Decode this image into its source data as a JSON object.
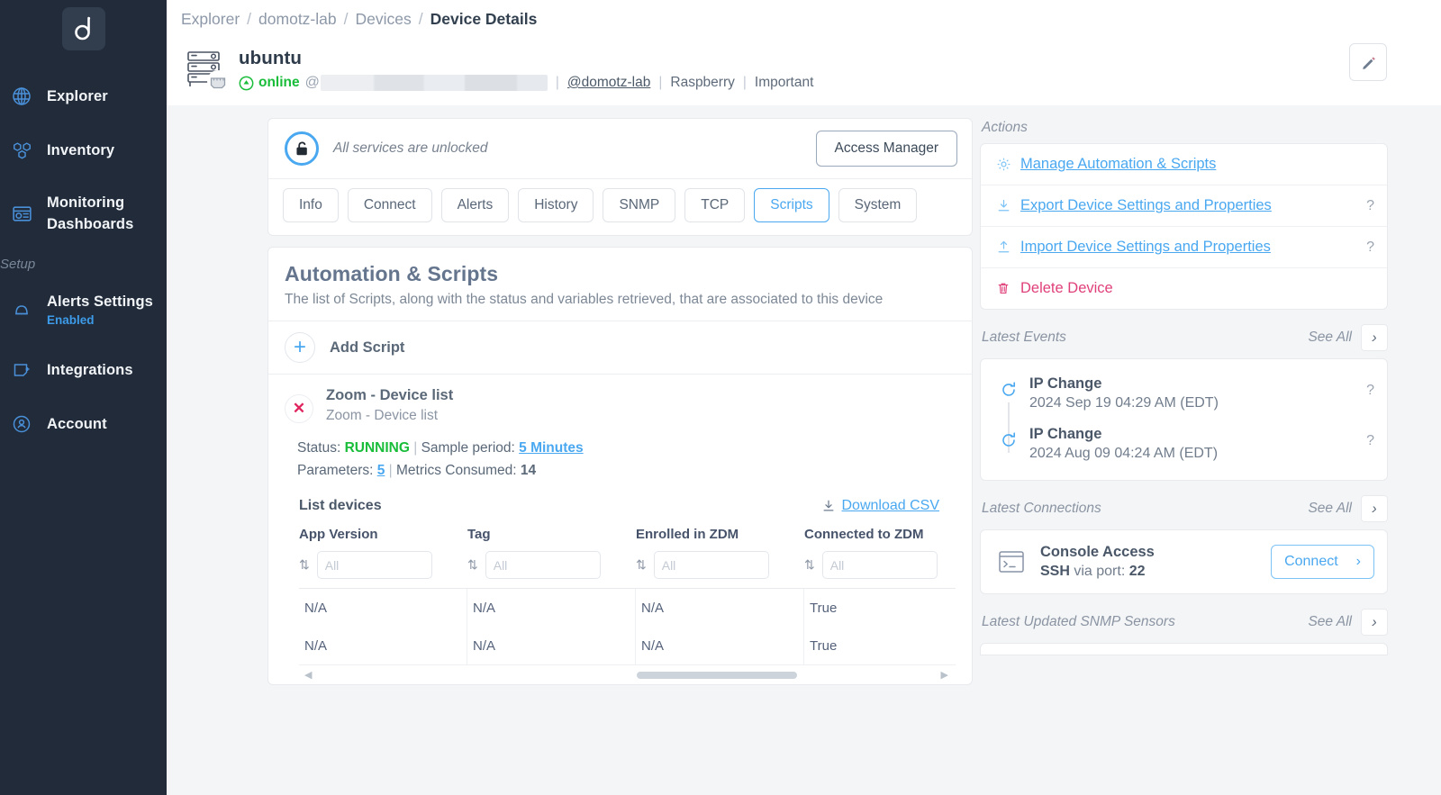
{
  "sidebar": {
    "logo_name": "domotz-logo",
    "items": [
      {
        "label": "Explorer",
        "icon": "globe-icon"
      },
      {
        "label": "Inventory",
        "icon": "cubes-icon"
      },
      {
        "label": "Monitoring Dashboards",
        "icon": "dashboard-icon"
      }
    ],
    "setup_label": "Setup",
    "setup_items": [
      {
        "label": "Alerts Settings",
        "sub": "Enabled",
        "icon": "bell-icon"
      },
      {
        "label": "Integrations",
        "sub": "",
        "icon": "integrations-icon"
      },
      {
        "label": "Account",
        "sub": "",
        "icon": "account-icon"
      }
    ]
  },
  "breadcrumb": {
    "items": [
      "Explorer",
      "domotz-lab",
      "Devices"
    ],
    "current": "Device Details",
    "separator": "/"
  },
  "device": {
    "name": "ubuntu",
    "status": "online",
    "at_symbol": "@",
    "ip_redacted": true,
    "group_link": "@domotz-lab",
    "tags": [
      "Raspberry",
      "Important"
    ],
    "edit_icon": "pencil-icon"
  },
  "access": {
    "message": "All services are unlocked",
    "button_label": "Access Manager",
    "lock_icon": "unlocked-padlock-icon"
  },
  "tabs": [
    {
      "label": "Info",
      "active": false
    },
    {
      "label": "Connect",
      "active": false
    },
    {
      "label": "Alerts",
      "active": false
    },
    {
      "label": "History",
      "active": false
    },
    {
      "label": "SNMP",
      "active": false
    },
    {
      "label": "TCP",
      "active": false
    },
    {
      "label": "Scripts",
      "active": true
    },
    {
      "label": "System",
      "active": false
    }
  ],
  "automation": {
    "title": "Automation & Scripts",
    "description": "The list of Scripts, along with the status and variables retrieved, that are associated to this device",
    "add_script_label": "Add Script",
    "add_script_icon": "plus-icon",
    "script": {
      "name": "Zoom - Device list",
      "description": "Zoom - Device list",
      "remove_icon": "close-x-icon",
      "status_label": "Status:",
      "status_value": "RUNNING",
      "sample_period_label": "Sample period:",
      "sample_period_value": "5 Minutes",
      "parameters_label": "Parameters:",
      "parameters_value": "5",
      "metrics_label": "Metrics Consumed:",
      "metrics_value": "14",
      "separator": "|"
    }
  },
  "table": {
    "title": "List devices",
    "download_label": "Download CSV",
    "download_icon": "download-icon",
    "sort_icon": "sort-updown-icon",
    "filter_placeholder": "All",
    "columns": [
      "App Version",
      "Tag",
      "Enrolled in ZDM",
      "Connected to ZDM"
    ],
    "rows": [
      [
        "N/A",
        "N/A",
        "N/A",
        "True"
      ],
      [
        "N/A",
        "N/A",
        "N/A",
        "True"
      ]
    ]
  },
  "right_panel": {
    "actions_label": "Actions",
    "actions": [
      {
        "label": "Manage Automation & Scripts",
        "icon": "gear-icon",
        "help": false,
        "danger": false
      },
      {
        "label": "Export Device Settings and Properties",
        "icon": "export-down-icon",
        "help": true,
        "danger": false
      },
      {
        "label": "Import Device Settings and Properties",
        "icon": "import-up-icon",
        "help": true,
        "danger": false
      },
      {
        "label": "Delete Device",
        "icon": "trash-icon",
        "help": false,
        "danger": true
      }
    ],
    "help_glyph": "?",
    "events_label": "Latest Events",
    "see_all_label": "See All",
    "see_all_icon": "chevron-right-icon",
    "events": [
      {
        "title": "IP Change",
        "time": "2024 Sep 19 04:29 AM (EDT)",
        "icon": "refresh-circle-icon",
        "badge": "?"
      },
      {
        "title": "IP Change",
        "time": "2024 Aug 09 04:24 AM (EDT)",
        "icon": "refresh-circle-icon",
        "badge": "?"
      }
    ],
    "connections_label": "Latest Connections",
    "connection": {
      "title": "Console Access",
      "protocol": "SSH",
      "via_text": "via port:",
      "port": "22",
      "button_label": "Connect",
      "button_icon": "chevron-right-icon",
      "icon": "terminal-icon"
    },
    "snmp_label": "Latest Updated SNMP Sensors"
  },
  "colors": {
    "sidebar_bg": "#212b39",
    "accent_blue": "#4aa8f0",
    "online_green": "#19bd3a",
    "danger_pink": "#e0407a",
    "page_bg": "#f4f5f7"
  }
}
